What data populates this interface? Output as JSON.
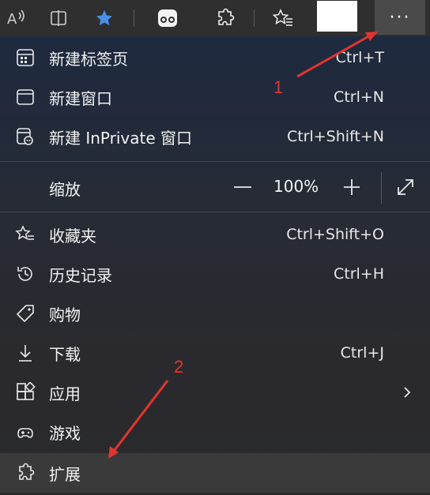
{
  "toolbar": {
    "icons": [
      "read-aloud-icon",
      "split-screen-icon",
      "favorite-star-icon",
      "game-controller-icon",
      "extensions-puzzle-icon",
      "favorites-icon"
    ],
    "more_label": "···"
  },
  "menu": {
    "items": [
      {
        "label": "新建标签页",
        "shortcut": "Ctrl+T",
        "icon": "new-tab-icon"
      },
      {
        "label": "新建窗口",
        "shortcut": "Ctrl+N",
        "icon": "new-window-icon"
      },
      {
        "label": "新建 InPrivate 窗口",
        "shortcut": "Ctrl+Shift+N",
        "icon": "inprivate-icon"
      }
    ],
    "zoom": {
      "label": "缩放",
      "value": "100%",
      "minus": "—",
      "plus": "+"
    },
    "items2": [
      {
        "label": "收藏夹",
        "shortcut": "Ctrl+Shift+O",
        "icon": "favorites-icon"
      },
      {
        "label": "历史记录",
        "shortcut": "Ctrl+H",
        "icon": "history-icon"
      },
      {
        "label": "购物",
        "shortcut": "",
        "icon": "shopping-tag-icon"
      },
      {
        "label": "下载",
        "shortcut": "Ctrl+J",
        "icon": "download-icon"
      },
      {
        "label": "应用",
        "shortcut": "",
        "icon": "apps-icon"
      },
      {
        "label": "游戏",
        "shortcut": "",
        "icon": "games-icon"
      },
      {
        "label": "扩展",
        "shortcut": "",
        "icon": "extensions-icon"
      }
    ]
  },
  "annotations": {
    "step1": "1",
    "step2": "2"
  },
  "colors": {
    "annotation": "#e3342f",
    "accent_star": "#4a8fe7"
  }
}
